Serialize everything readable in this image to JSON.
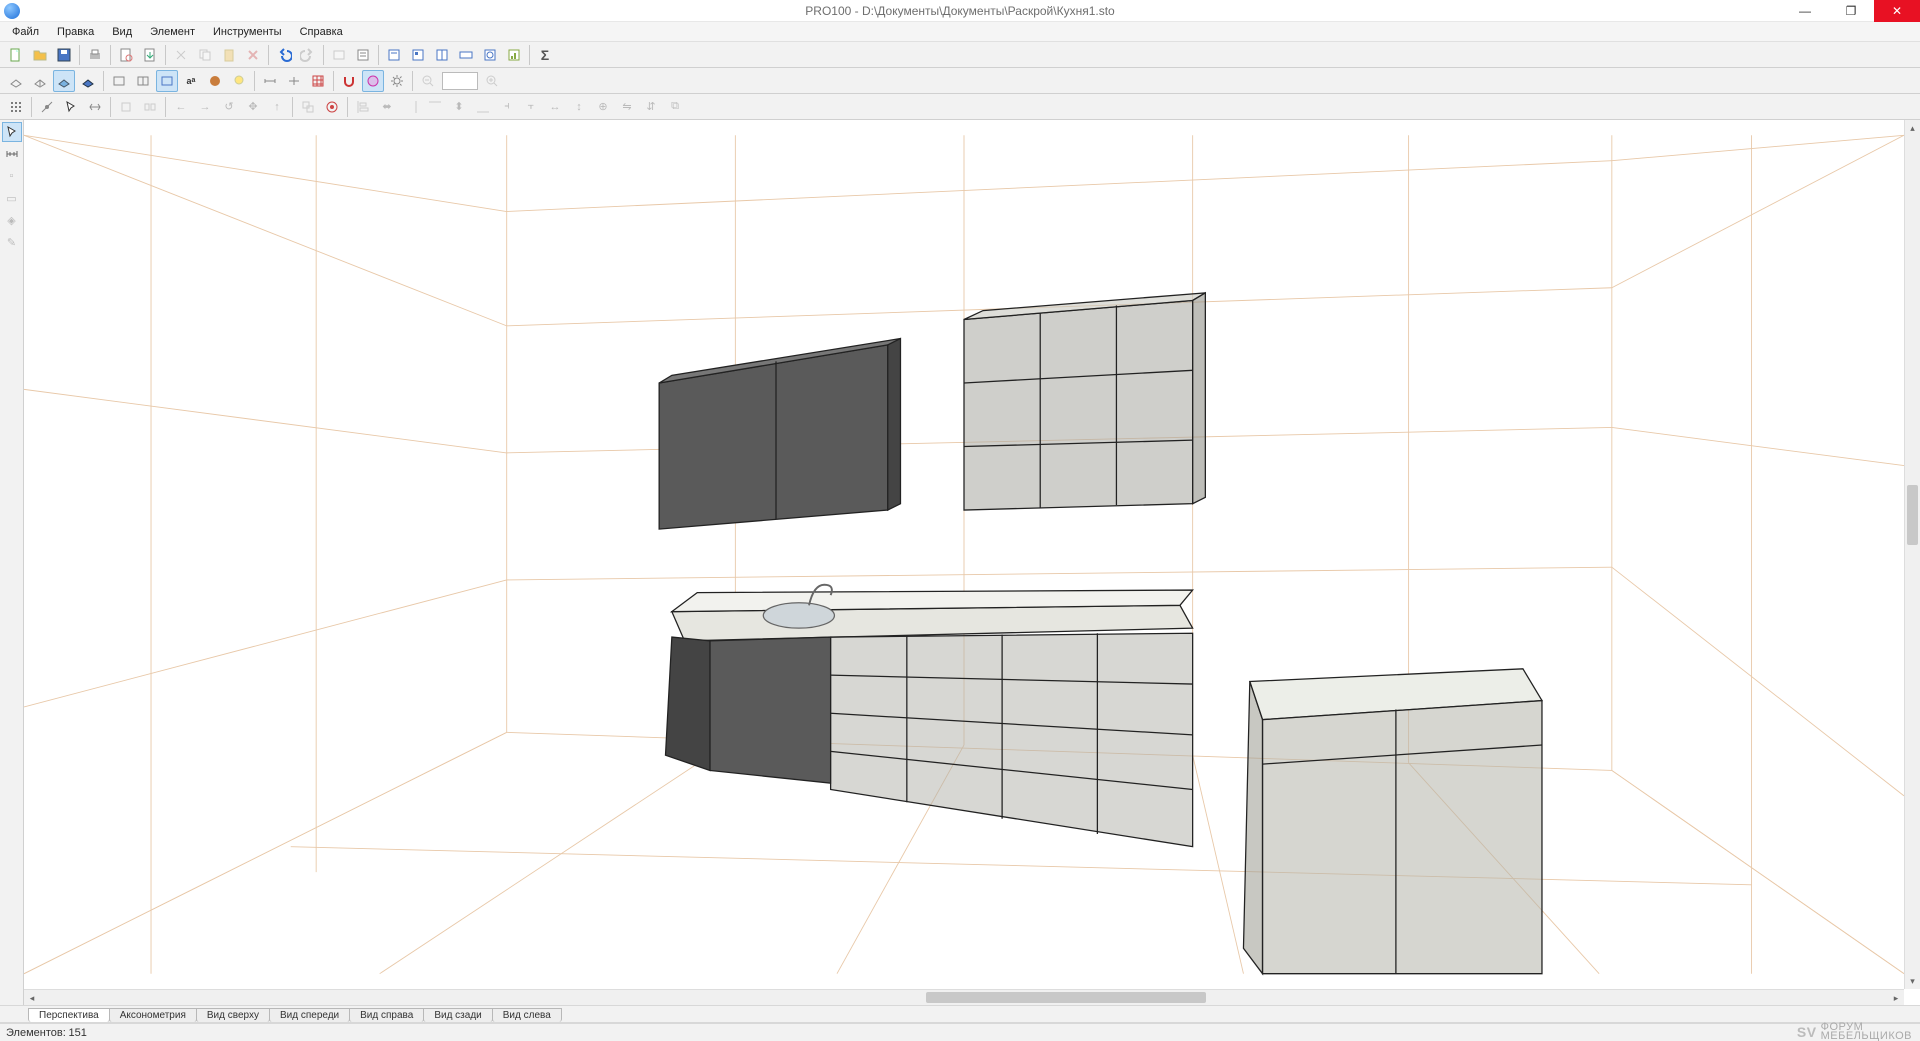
{
  "title": "PRO100 - D:\\Документы\\Документы\\Раскрой\\Кухня1.sto",
  "menus": [
    "Файл",
    "Правка",
    "Вид",
    "Элемент",
    "Инструменты",
    "Справка"
  ],
  "tabs": [
    "Перспектива",
    "Аксонометрия",
    "Вид сверху",
    "Вид спереди",
    "Вид справа",
    "Вид сзади",
    "Вид слева"
  ],
  "active_tab": 0,
  "status": {
    "label": "Элементов:",
    "count": "151"
  },
  "watermark": {
    "brand": "SV",
    "line1": "ФОРУМ",
    "line2": "МЕБЕЛЬЩИКОВ"
  },
  "toolbar_zoom": ""
}
